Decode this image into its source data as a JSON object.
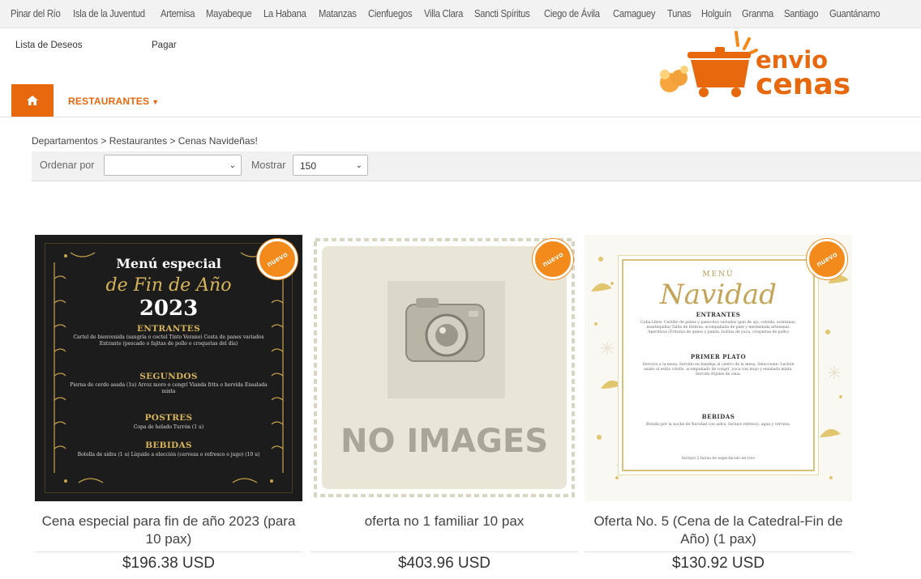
{
  "provinces": [
    "Pinar del Río",
    "Isla de la Juventud",
    "Artemisa",
    "Mayabeque",
    "La Habana",
    "Matanzas",
    "Cienfuegos",
    "Villa Clara",
    "Sancti Spíritus",
    "Ciego de Ávila",
    "Camaguey",
    "Tunas",
    "Holguín",
    "Granma",
    "Santiago",
    "Guantánamo"
  ],
  "user_links": {
    "wishlist": "Lista de Deseos",
    "checkout": "Pagar"
  },
  "logo": {
    "line1": "envio",
    "line2": "cenas"
  },
  "nav": {
    "home_icon": "home-icon",
    "restaurants": "RESTAURANTES"
  },
  "breadcrumb": "Departamentos > Restaurantes > Cenas Navideñas!",
  "sort": {
    "order_label": "Ordenar por",
    "order_value": "",
    "show_label": "Mostrar",
    "show_value": "150"
  },
  "badge_text": "nuevo",
  "products": [
    {
      "title": "Cena especial para fin de año 2023 (para 10 pax)",
      "price": "$196.38 USD",
      "image": {
        "h1": "Menú especial",
        "h2": "de Fin de Año",
        "year": "2023",
        "sections": [
          "ENTRANTES",
          "SEGUNDOS",
          "POSTRES",
          "BEBIDAS"
        ],
        "entrantes": "Cartel de bienvenida (sangría o coctel Tinto Verano) Cesta de panes variados Entrante (pescado o fajitas de pollo o croquetas del día)",
        "segundos": "Pierna de cerdo asada (1u) Arroz moro o congrí Vianda frita o hervida Ensalada mixta",
        "postres": "Copa de helado Turrón (1 u)",
        "bebidas": "Botella de sidra (1 u) Líquido a elección (cerveza o refresco o jugo) (10 u)"
      }
    },
    {
      "title": "oferta no 1 familiar 10 pax",
      "price": "$403.96 USD",
      "image": {
        "placeholder": "NO IMAGES"
      }
    },
    {
      "title": "Oferta No. 5 (Cena de la Catedral-Fin de Año) (1 pax)",
      "price": "$130.92 USD",
      "image": {
        "menu": "MENÚ",
        "title": "Navidad",
        "sections": [
          "ENTRANTES",
          "PRIMER PLATO",
          "BEBIDAS"
        ],
        "entrantes": "Cuba Libre. Cestillo de panes y panecitos variados (pan de ajo, cebolla, aceitunas, mantequilla) Tabla de Hebras, acompañada de pate y mermelada artesanal. Aperitivos (Frituras de queso y jamón, bolitas de yuca, croquetas de pollo)",
        "primer": "Servicio a la mesa. Servido en bandeja al centro de la mesa. Seleccione: Lechón asado al estilo criollo, acompañado de congrí, yuca con mojo y ensalada mixta. Servido frijoles de cena.",
        "bebidas": "Brindis por la noche de Navidad con sidra. Incluye refresco, agua y cerveza.",
        "footer": "Incluye 2 horas de espectáculo en vivo"
      }
    }
  ],
  "colors": {
    "accent": "#e7680d",
    "badge": "#f28a1c",
    "gold": "#d6b45a"
  }
}
